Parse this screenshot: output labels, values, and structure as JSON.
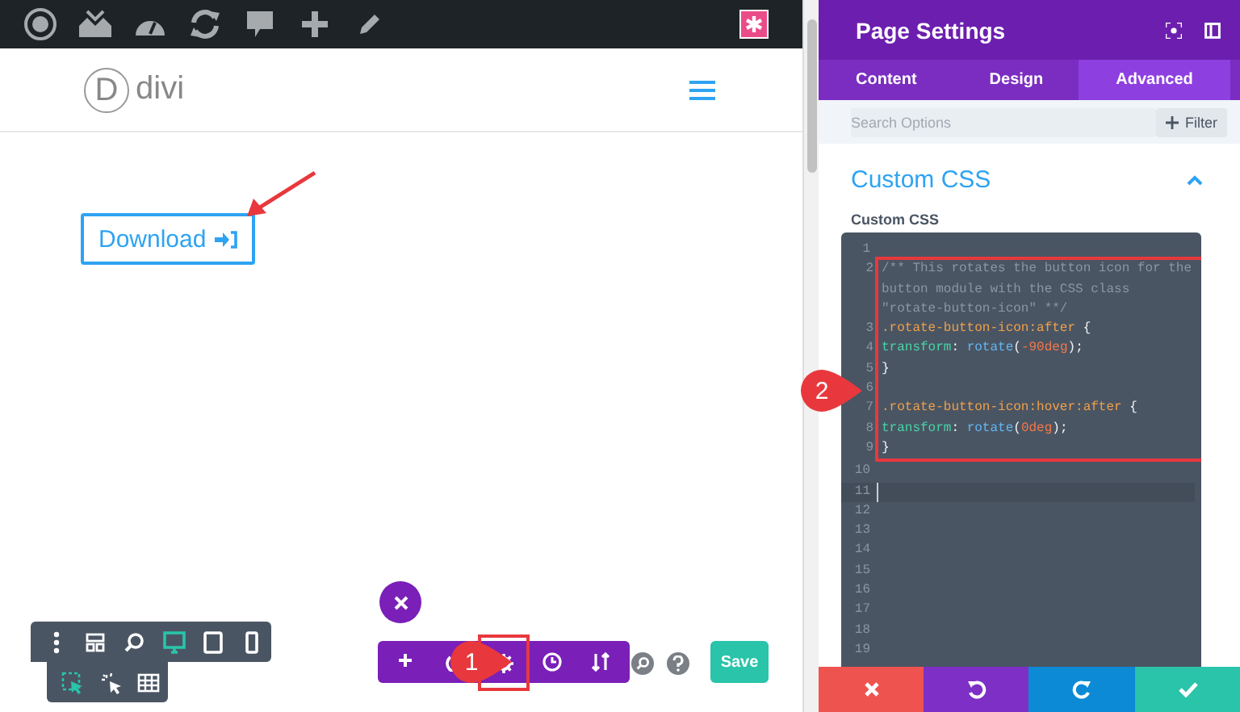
{
  "site": {
    "logo_letter": "D",
    "logo_text": "divi",
    "download_label": "Download"
  },
  "view_modes": [
    {
      "kind": "desktop",
      "selected": true
    },
    {
      "kind": "tablet",
      "selected": false
    },
    {
      "kind": "phone",
      "selected": false
    }
  ],
  "interaction_modes": [
    {
      "kind": "select",
      "selected": true
    },
    {
      "kind": "click",
      "selected": false
    },
    {
      "kind": "grid",
      "selected": false
    }
  ],
  "builder_bar": {
    "buttons": [
      {
        "kind": "add",
        "boxed": false
      },
      {
        "kind": "power",
        "boxed": false
      },
      {
        "kind": "settings",
        "boxed": true
      },
      {
        "kind": "history",
        "boxed": false
      },
      {
        "kind": "sort",
        "boxed": false
      }
    ],
    "save_label": "Save"
  },
  "callouts": [
    {
      "text": "1"
    },
    {
      "text": "2"
    }
  ],
  "panel": {
    "title": "Page Settings",
    "tabs": [
      {
        "label": "Content",
        "selected": false
      },
      {
        "label": "Design",
        "selected": false
      },
      {
        "label": "Advanced",
        "selected": true
      }
    ],
    "search": {
      "placeholder": "Search Options"
    },
    "filter_label": "Filter",
    "section": {
      "title": "Custom CSS",
      "expanded": true
    },
    "field_label": "Custom CSS",
    "code_lines": [
      {
        "number": "1",
        "boxed": false,
        "current": false
      },
      {
        "number": "2",
        "boxed": true,
        "current": false,
        "tokens": [
          {
            "kind": "comment",
            "text": "/** This rotates the button icon for the button module with the CSS class \"rotate-button-icon\" **/"
          }
        ]
      },
      {
        "number": "3",
        "boxed": true,
        "current": false,
        "tokens": [
          {
            "kind": "selector",
            "text": ".rotate-button-icon:after"
          },
          {
            "kind": "punct",
            "text": " {"
          }
        ]
      },
      {
        "number": "4",
        "boxed": true,
        "current": false,
        "tokens": [
          {
            "kind": "property",
            "text": "transform"
          },
          {
            "kind": "punct",
            "text": ": "
          },
          {
            "kind": "function",
            "text": "rotate"
          },
          {
            "kind": "punct",
            "text": "("
          },
          {
            "kind": "number",
            "text": "-90deg"
          },
          {
            "kind": "punct",
            "text": ");"
          }
        ]
      },
      {
        "number": "5",
        "boxed": true,
        "current": false,
        "tokens": [
          {
            "kind": "punct",
            "text": "}"
          }
        ]
      },
      {
        "number": "6",
        "boxed": true,
        "current": false
      },
      {
        "number": "7",
        "boxed": true,
        "current": false,
        "tokens": [
          {
            "kind": "selector",
            "text": ".rotate-button-icon:hover:after"
          },
          {
            "kind": "punct",
            "text": " {"
          }
        ]
      },
      {
        "number": "8",
        "boxed": true,
        "current": false,
        "tokens": [
          {
            "kind": "property",
            "text": "transform"
          },
          {
            "kind": "punct",
            "text": ": "
          },
          {
            "kind": "function",
            "text": "rotate"
          },
          {
            "kind": "punct",
            "text": "("
          },
          {
            "kind": "number",
            "text": "0deg"
          },
          {
            "kind": "punct",
            "text": ");"
          }
        ]
      },
      {
        "number": "9",
        "boxed": true,
        "current": false,
        "tokens": [
          {
            "kind": "punct",
            "text": "}"
          }
        ]
      },
      {
        "number": "10",
        "boxed": false,
        "current": false
      },
      {
        "number": "11",
        "boxed": false,
        "current": true
      },
      {
        "number": "12",
        "boxed": false,
        "current": false
      },
      {
        "number": "13",
        "boxed": false,
        "current": false
      },
      {
        "number": "14",
        "boxed": false,
        "current": false
      },
      {
        "number": "15",
        "boxed": false,
        "current": false
      },
      {
        "number": "16",
        "boxed": false,
        "current": false
      },
      {
        "number": "17",
        "boxed": false,
        "current": false
      },
      {
        "number": "18",
        "boxed": false,
        "current": false
      },
      {
        "number": "19",
        "boxed": false,
        "current": false
      }
    ]
  }
}
